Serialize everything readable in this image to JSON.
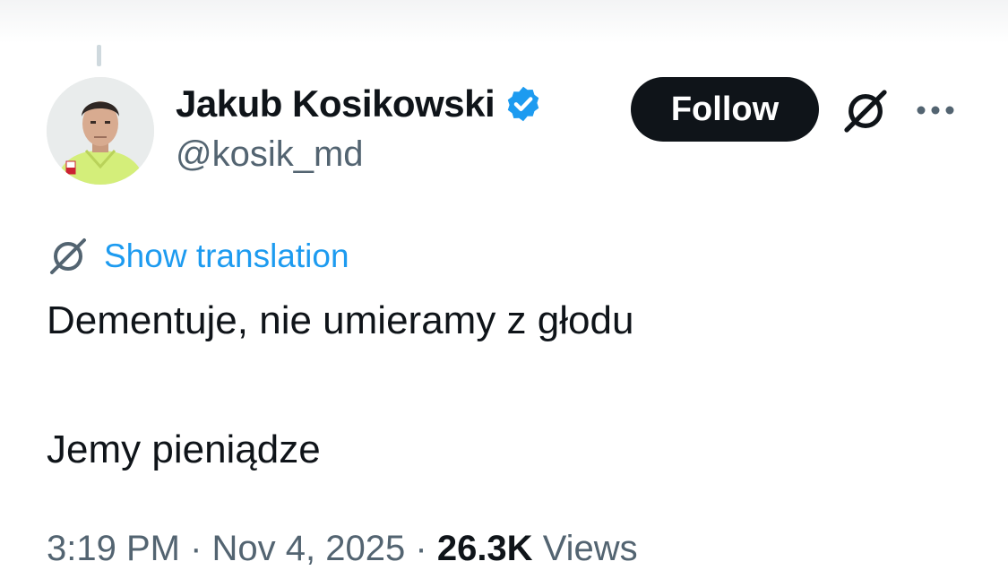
{
  "author": {
    "name": "Jakub Kosikowski",
    "handle": "@kosik_md",
    "verified_icon": "verified-badge-icon",
    "verified_color": "#1d9bf0"
  },
  "actions": {
    "follow_label": "Follow",
    "grok_icon": "grok-icon",
    "more_icon": "more-dots-icon"
  },
  "translation": {
    "label": "Show translation",
    "icon": "grok-translate-icon",
    "link_color": "#1d9bf0"
  },
  "tweet": {
    "lines": [
      "Dementuje, nie umieramy z głodu",
      "Jemy pieniądze"
    ]
  },
  "meta": {
    "time": "3:19 PM",
    "separator": "·",
    "date": "Nov 4, 2025",
    "views_count": "26.3K",
    "views_label": "Views"
  }
}
